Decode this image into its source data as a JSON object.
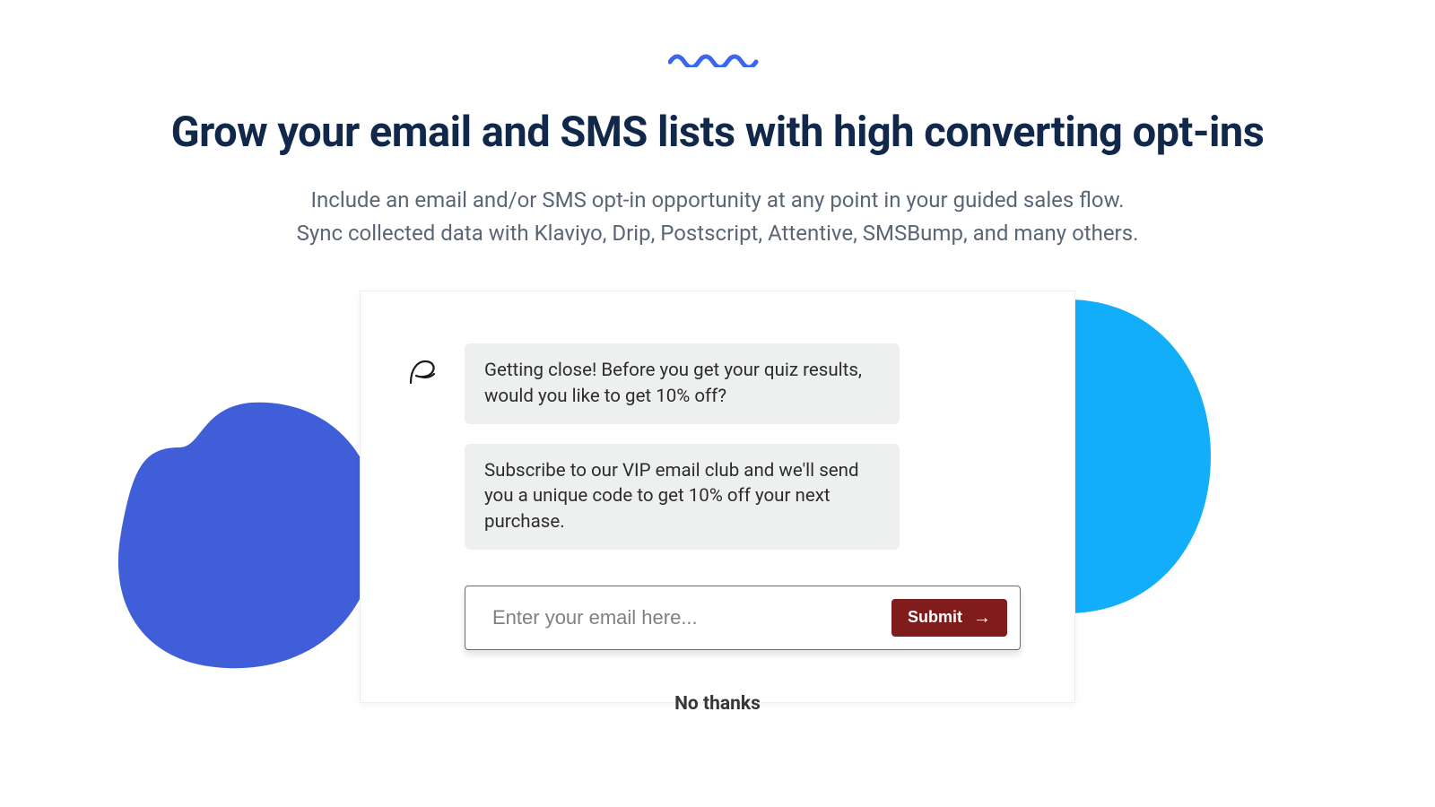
{
  "heading": "Grow your email and SMS lists with high converting opt-ins",
  "subheading_line1": "Include an email and/or SMS opt-in opportunity at any point in your guided sales flow.",
  "subheading_line2": "Sync collected data with Klaviyo, Drip, Postscript, Attentive, SMSBump, and many others.",
  "chat": {
    "bubble1": "Getting close! Before you get your quiz results, would you like to get 10% off?",
    "bubble2": "Subscribe to our VIP email club and we'll send you a unique code to get 10% off your next purchase."
  },
  "form": {
    "email_placeholder": "Enter your email here...",
    "submit_label": "Submit",
    "skip_label": "No thanks"
  },
  "colors": {
    "heading": "#11284b",
    "subheading": "#5a6675",
    "blob_left": "#3f5ed8",
    "blob_right": "#12aef9",
    "bubble_bg": "#eef0f0",
    "submit_bg": "#801c1c"
  }
}
